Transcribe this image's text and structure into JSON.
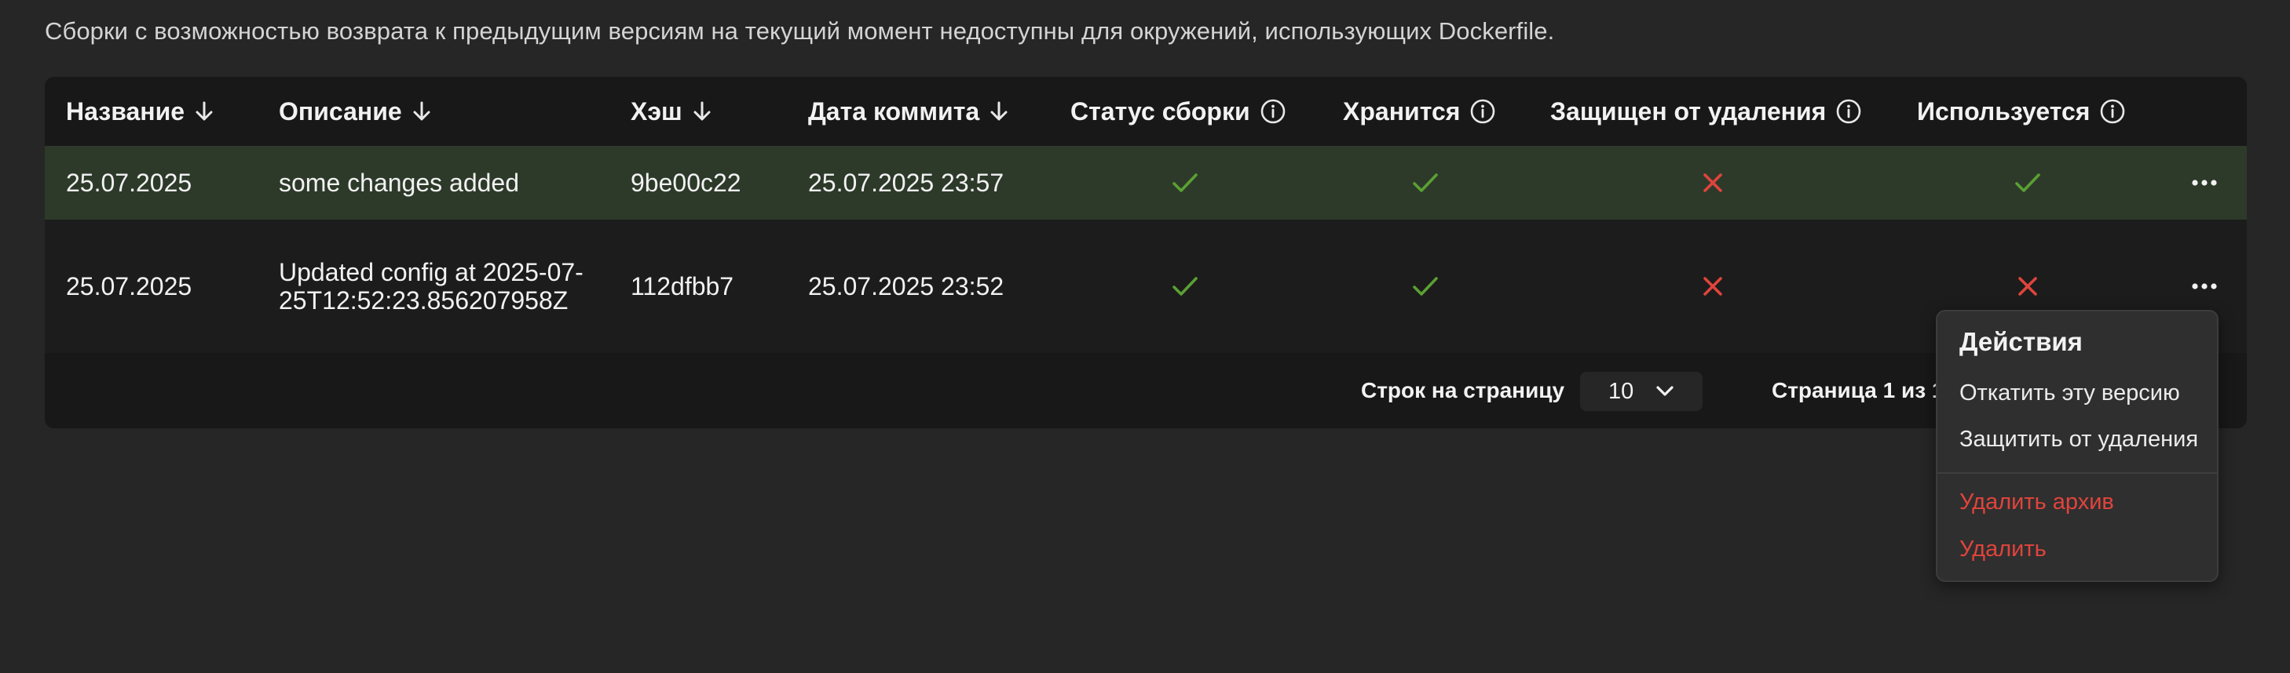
{
  "notice": "Сборки с возможностью возврата к предыдущим версиям на текущий момент недоступны для окружений, использующих Dockerfile.",
  "table": {
    "columns": {
      "name": "Название",
      "description": "Описание",
      "hash": "Хэш",
      "commit_date": "Дата коммита",
      "build_status": "Статус сборки",
      "stored": "Хранится",
      "protected": "Защищен от удаления",
      "used": "Используется"
    },
    "rows": [
      {
        "name": "25.07.2025",
        "description": "some changes added",
        "hash": "9be00c22",
        "commit_date": "25.07.2025 23:57",
        "build_status": "check",
        "stored": "check",
        "protected": "cross",
        "used": "check",
        "highlighted": true
      },
      {
        "name": "25.07.2025",
        "description": "Updated config at 2025-07-25T12:52:23.856207958Z",
        "hash": "112dfbb7",
        "commit_date": "25.07.2025 23:52",
        "build_status": "check",
        "stored": "check",
        "protected": "cross",
        "used": "cross",
        "highlighted": false
      }
    ]
  },
  "pagination": {
    "rows_per_page_label": "Строк на страницу",
    "rows_per_page_value": "10",
    "page_info": "Страница 1 из 1"
  },
  "actions_menu": {
    "title": "Действия",
    "rollback": "Откатить эту версию",
    "protect": "Защитить от удаления",
    "delete_archive": "Удалить архив",
    "delete": "Удалить"
  },
  "colors": {
    "check": "#5aa033",
    "cross": "#e0443c",
    "highlight_row": "#2d3a2a",
    "danger": "#e0443c"
  }
}
